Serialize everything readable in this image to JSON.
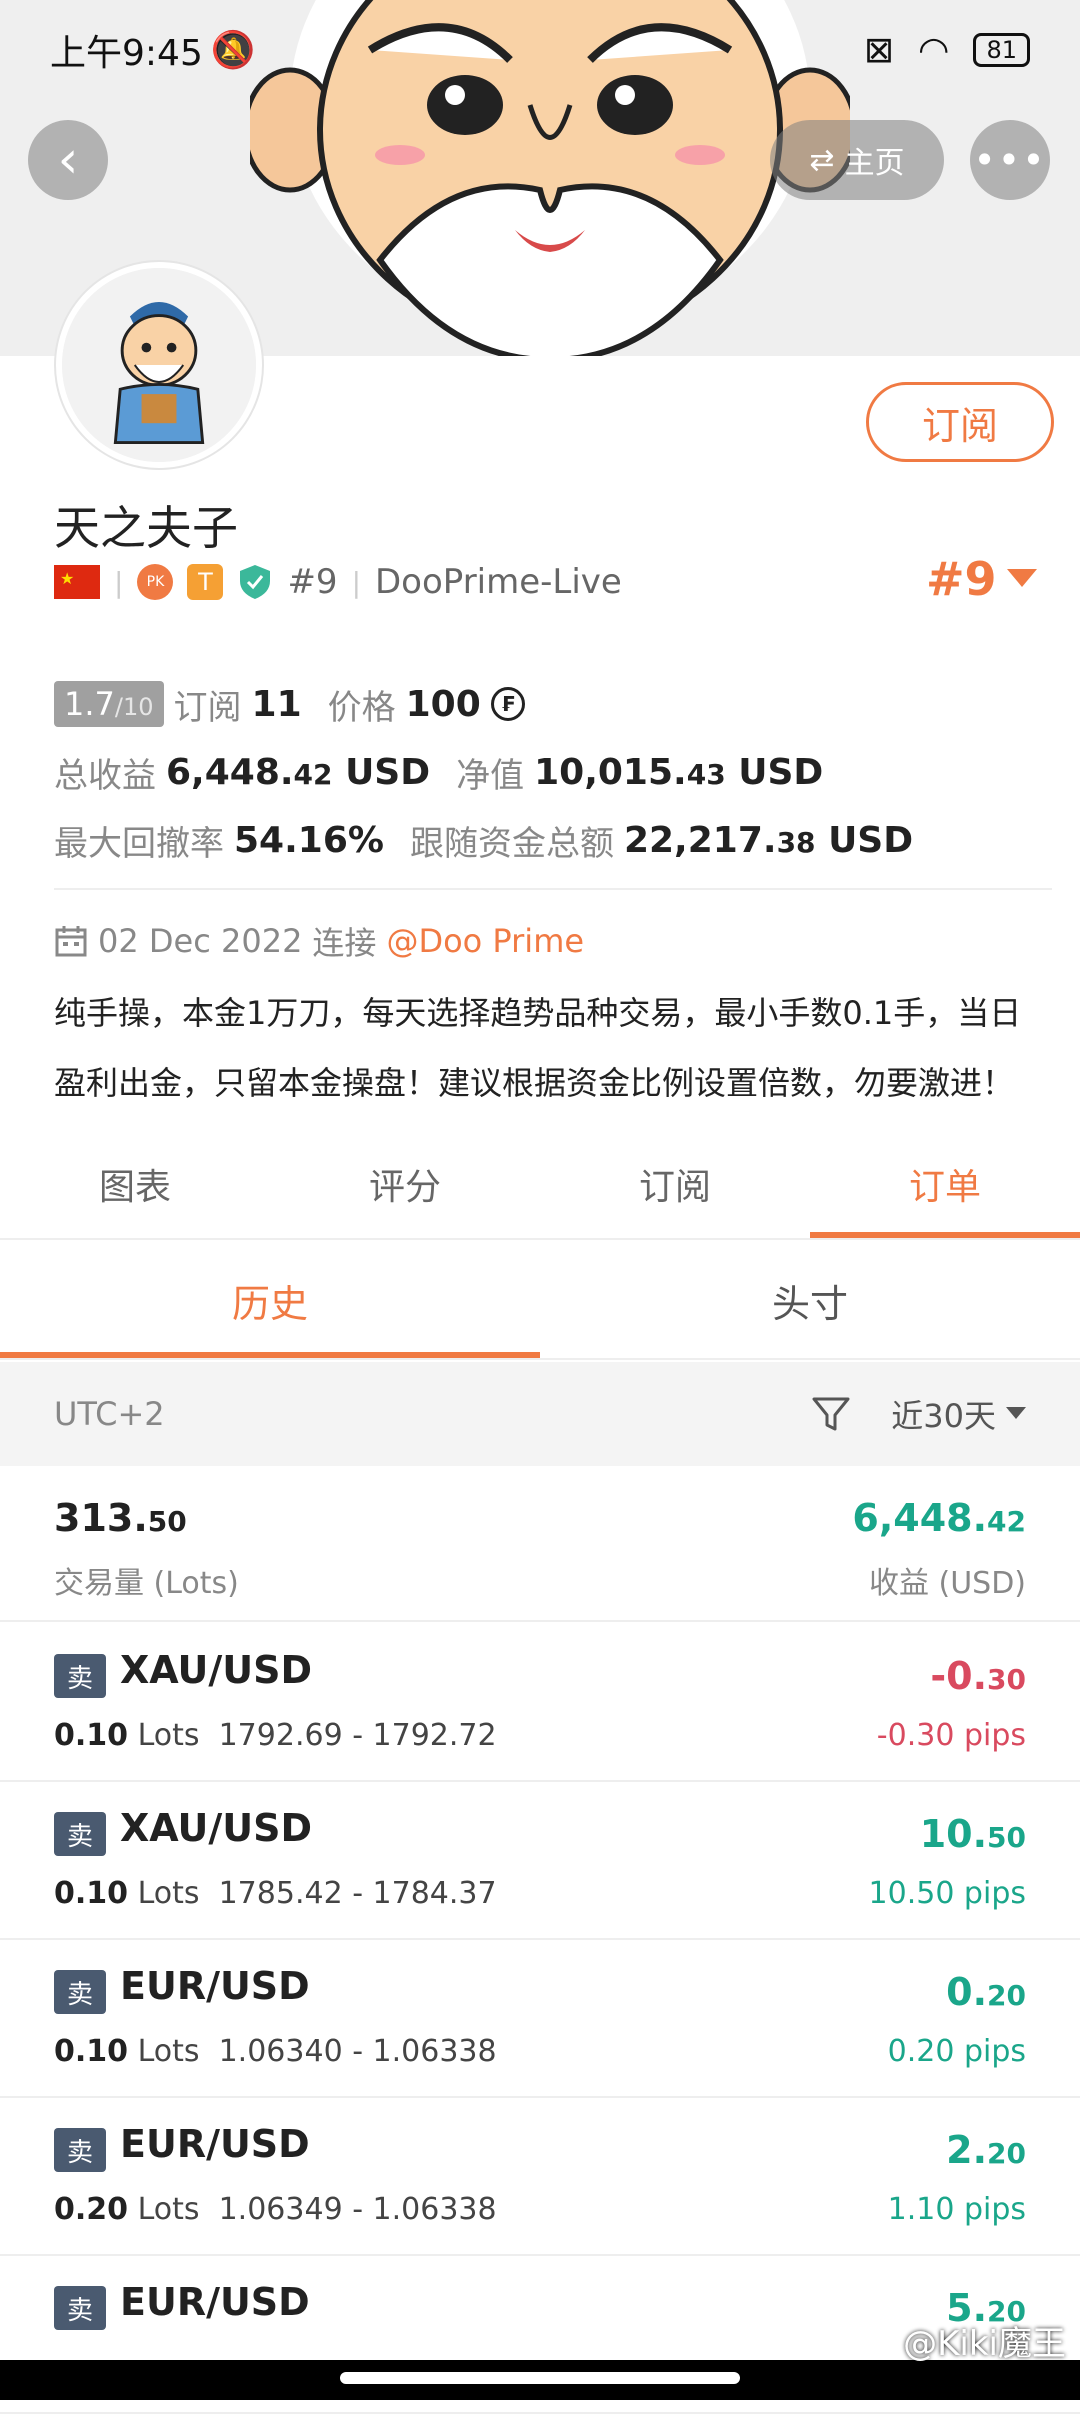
{
  "status_bar": {
    "time": "上午9:45",
    "battery": "81"
  },
  "nav": {
    "home_label": "主页",
    "more_label": "•••",
    "back_label": "‹"
  },
  "profile": {
    "name": "天之夫子",
    "subscribe_label": "订阅",
    "flag_star": "★",
    "pk_badge": "PK",
    "t_badge": "T",
    "rank_small": "#9",
    "server": "DooPrime-Live",
    "rank_big": "#9"
  },
  "stats": {
    "score": "1.7",
    "score_max": "/10",
    "subs_label": "订阅",
    "subs": "11",
    "price_label": "价格",
    "price": "100",
    "coin_symbol": "₣",
    "total_profit_label": "总收益",
    "total_profit_main": "6,448.",
    "total_profit_dec": "42",
    "total_profit_unit": "USD",
    "equity_label": "净值",
    "equity_main": "10,015.",
    "equity_dec": "43",
    "equity_unit": "USD",
    "drawdown_label": "最大回撤率",
    "drawdown": "54.16%",
    "follow_label": "跟随资金总额",
    "follow_main": "22,217.",
    "follow_dec": "38",
    "follow_unit": "USD"
  },
  "connection": {
    "date": "02 Dec 2022",
    "connect_label": "连接",
    "broker": "@Doo Prime"
  },
  "description": "纯手操，本金1万刀，每天选择趋势品种交易，最小手数0.1手，当日盈利出金，只留本金操盘！建议根据资金比例设置倍数，勿要激进！",
  "tabs": [
    {
      "label": "图表"
    },
    {
      "label": "评分"
    },
    {
      "label": "订阅"
    },
    {
      "label": "订单"
    }
  ],
  "subtabs": [
    {
      "label": "历史"
    },
    {
      "label": "头寸"
    }
  ],
  "filter": {
    "timezone": "UTC+2",
    "range": "近30天"
  },
  "summary": {
    "lots_main": "313.",
    "lots_dec": "50",
    "lots_label": "交易量 (Lots)",
    "profit_main": "6,448.",
    "profit_dec": "42",
    "profit_label": "收益 (USD)"
  },
  "orders": [
    {
      "side": "卖",
      "symbol": "XAU/USD",
      "lots": "0.10",
      "lots_unit": "Lots",
      "prices": "1792.69 - 1792.72",
      "pl_main": "-0.",
      "pl_dec": "30",
      "pips": "-0.30 pips"
    },
    {
      "side": "卖",
      "symbol": "XAU/USD",
      "lots": "0.10",
      "lots_unit": "Lots",
      "prices": "1785.42 - 1784.37",
      "pl_main": "10.",
      "pl_dec": "50",
      "pips": "10.50 pips"
    },
    {
      "side": "卖",
      "symbol": "EUR/USD",
      "lots": "0.10",
      "lots_unit": "Lots",
      "prices": "1.06340 - 1.06338",
      "pl_main": "0.",
      "pl_dec": "20",
      "pips": "0.20 pips"
    },
    {
      "side": "卖",
      "symbol": "EUR/USD",
      "lots": "0.20",
      "lots_unit": "Lots",
      "prices": "1.06349 - 1.06338",
      "pl_main": "2.",
      "pl_dec": "20",
      "pips": "1.10 pips"
    },
    {
      "side": "卖",
      "symbol": "EUR/USD",
      "pl_main": "5.",
      "pl_dec": "20"
    }
  ],
  "watermark": "@Kiki魔王",
  "colors": {
    "accent": "#f07a43",
    "positive": "#1aa68a",
    "negative": "#d94a5f",
    "side_badge": "#4a5a70"
  }
}
